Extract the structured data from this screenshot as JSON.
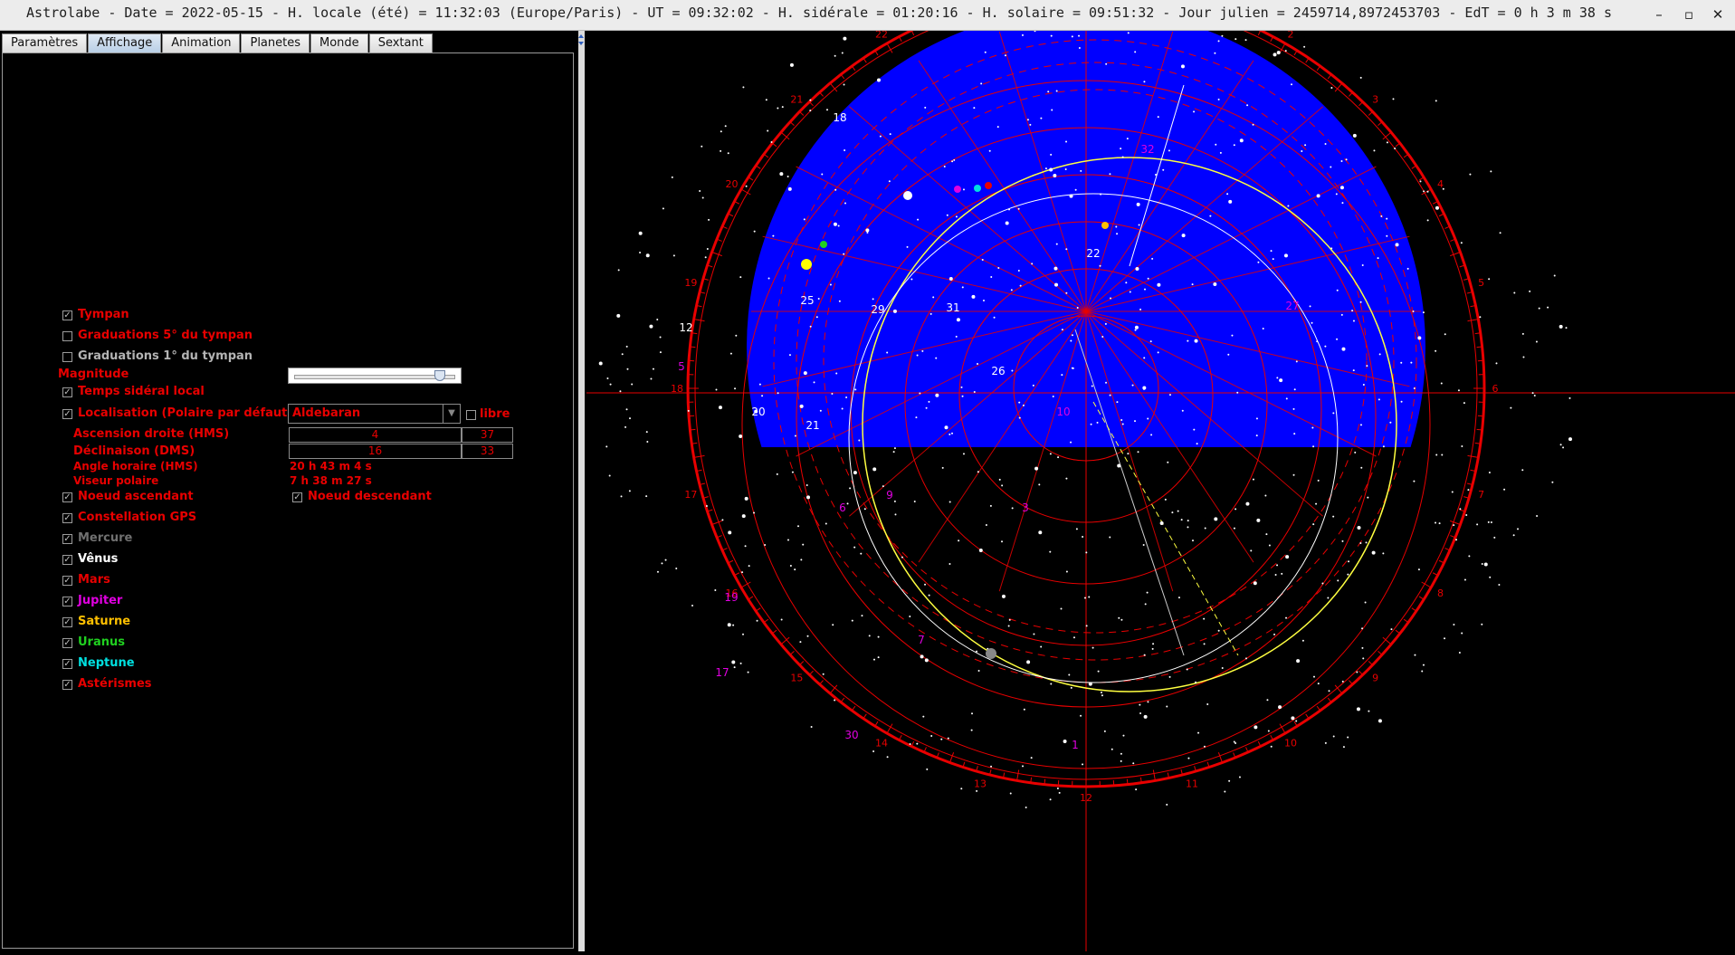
{
  "window": {
    "title": "Astrolabe - Date = 2022-05-15 - H. locale (été) = 11:32:03 (Europe/Paris) - UT = 09:32:02 - H. sidérale = 01:20:16 - H. solaire = 09:51:32 - Jour julien = 2459714,8972453703 - EdT = 0 h 3 m 38 s",
    "minimize": "–",
    "maximize": "▫",
    "close": "✕"
  },
  "tabs": [
    {
      "label": "Paramètres"
    },
    {
      "label": "Affichage"
    },
    {
      "label": "Animation"
    },
    {
      "label": "Planetes"
    },
    {
      "label": "Monde"
    },
    {
      "label": "Sextant"
    }
  ],
  "selected_tab": "Affichage",
  "options": {
    "tympan": {
      "label": "Tympan",
      "checked": true,
      "color": "#e80000"
    },
    "grad5": {
      "label": "Graduations 5° du tympan",
      "checked": false,
      "color": "#e80000"
    },
    "grad1": {
      "label": "Graduations 1° du tympan",
      "checked": false,
      "color": "#b4b4b4"
    },
    "magnitude": {
      "label": "Magnitude",
      "value_fraction": 0.92
    },
    "temps_sideral": {
      "label": "Temps sidéral local",
      "checked": true,
      "color": "#e80000"
    },
    "localisation": {
      "label": "Localisation (Polaire par défaut)",
      "checked": true,
      "color": "#e80000",
      "star": "Aldebaran",
      "libre_label": "libre",
      "libre_checked": false
    },
    "ascension": {
      "label": "Ascension droite (HMS)",
      "v1": "4",
      "v2": "37"
    },
    "declinaison": {
      "label": "Déclinaison (DMS)",
      "v1": "16",
      "v2": "33"
    },
    "angle_horaire": {
      "label": "Angle horaire (HMS)",
      "value": "20 h 43 m 4 s"
    },
    "viseur": {
      "label": "Viseur polaire",
      "value": "7 h 38 m 27 s"
    },
    "noeud_asc": {
      "label": "Noeud ascendant",
      "checked": true,
      "color": "#e80000"
    },
    "noeud_desc": {
      "label": "Noeud descendant",
      "checked": true,
      "color": "#e80000"
    },
    "gps": {
      "label": "Constellation GPS",
      "checked": true,
      "color": "#e80000"
    }
  },
  "planets": [
    {
      "label": "Mercure",
      "checked": true,
      "color": "#707070"
    },
    {
      "label": "Vênus",
      "checked": true,
      "color": "#ffffff"
    },
    {
      "label": "Mars",
      "checked": true,
      "color": "#e80000"
    },
    {
      "label": "Jupiter",
      "checked": true,
      "color": "#e000e0"
    },
    {
      "label": "Saturne",
      "checked": true,
      "color": "#ffc000"
    },
    {
      "label": "Uranus",
      "checked": true,
      "color": "#20d020"
    },
    {
      "label": "Neptune",
      "checked": true,
      "color": "#00e0e0"
    },
    {
      "label": "Astérismes",
      "checked": true,
      "color": "#e80000"
    }
  ],
  "astrolabe": {
    "hour_labels": [
      "0",
      "1",
      "2",
      "3",
      "4",
      "5",
      "6",
      "7",
      "8",
      "9",
      "10",
      "11",
      "12",
      "13",
      "14",
      "15",
      "16",
      "17",
      "18",
      "19",
      "20",
      "21",
      "22",
      "23"
    ],
    "gps_numbers": [
      {
        "t": "18",
        "c": "#ffffff"
      },
      {
        "t": "22",
        "c": "#ffffff"
      },
      {
        "t": "25",
        "c": "#ffffff"
      },
      {
        "t": "29",
        "c": "#ffffff"
      },
      {
        "t": "31",
        "c": "#ffffff"
      },
      {
        "t": "12",
        "c": "#ffffff"
      },
      {
        "t": "26",
        "c": "#ffffff"
      },
      {
        "t": "20",
        "c": "#ffffff"
      },
      {
        "t": "21",
        "c": "#ffffff"
      },
      {
        "t": "5",
        "c": "#e000e0"
      },
      {
        "t": "32",
        "c": "#e000e0"
      },
      {
        "t": "27",
        "c": "#e000e0"
      },
      {
        "t": "13",
        "c": "#e000e0"
      },
      {
        "t": "19",
        "c": "#e000e0"
      },
      {
        "t": "17",
        "c": "#e000e0"
      },
      {
        "t": "30",
        "c": "#e000e0"
      },
      {
        "t": "1",
        "c": "#e000e0"
      },
      {
        "t": "6",
        "c": "#e000e0"
      },
      {
        "t": "3",
        "c": "#e000e0"
      },
      {
        "t": "7",
        "c": "#e000e0"
      },
      {
        "t": "10",
        "c": "#e000e0"
      },
      {
        "t": "9",
        "c": "#e000e0"
      }
    ],
    "colors": {
      "sky": "#0000ff",
      "grid": "#e80000",
      "ecliptic": "#ffff40",
      "horizon": "#ffffff"
    }
  }
}
